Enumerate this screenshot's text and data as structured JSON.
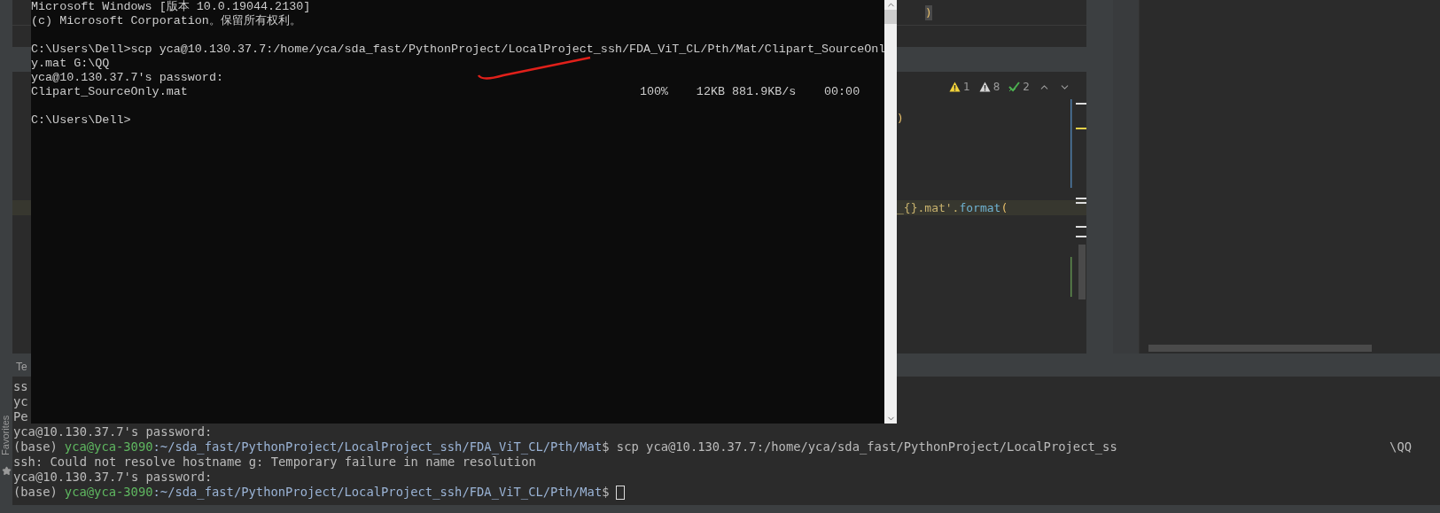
{
  "console_window": {
    "blocks": [
      [
        {
          "kind": "text",
          "text": "Microsoft Windows [版本 10.0.19044.2130]"
        },
        {
          "kind": "text",
          "text": "(c) Microsoft Corporation。保留所有权利。"
        }
      ],
      [
        {
          "kind": "text",
          "text": "C:\\Users\\Dell>scp yca@10.130.37.7:/home/yca/sda_fast/PythonProject/LocalProject_ssh/FDA_ViT_CL/Pth/Mat/Clipart_SourceOnl"
        },
        {
          "kind": "text",
          "text": "y.mat G:\\QQ"
        },
        {
          "kind": "text",
          "text": "yca@10.130.37.7's password:"
        },
        {
          "kind": "progress",
          "file": "Clipart_SourceOnly.mat",
          "percent": "100%",
          "size": "12KB",
          "speed": "881.9KB/s",
          "time": "00:00"
        }
      ],
      [
        {
          "kind": "text",
          "text": "C:\\Users\\Dell>"
        }
      ]
    ]
  },
  "editor": {
    "lines": [
      {
        "tokens": [
          {
            "kind": "paren",
            "text": ")"
          }
        ],
        "highlighted": false
      },
      {
        "tokens": [
          {
            "kind": "paren",
            "text": ")"
          }
        ],
        "highlighted": false
      },
      {
        "tokens": [
          {
            "kind": "string",
            "text": "_{}.mat'."
          },
          {
            "kind": "method",
            "text": "format"
          },
          {
            "kind": "paren",
            "text": "("
          }
        ],
        "highlighted": true
      }
    ],
    "inspections": [
      {
        "kind": "warning",
        "count": "1"
      },
      {
        "kind": "weak-warning",
        "count": "8"
      },
      {
        "kind": "typo",
        "count": "2"
      }
    ]
  },
  "terminal": {
    "tab": "Te",
    "hidden_lines": [
      "ss",
      "yc",
      "Pe"
    ],
    "lines": [
      {
        "kind": "output",
        "text": "yca@10.130.37.7's password:"
      },
      {
        "kind": "prompt",
        "env": "(base)",
        "user": "yca@yca-3090",
        "path": ":~/sda_fast/PythonProject/LocalProject_ssh/FDA_ViT_CL/Pth/Mat",
        "command": "$ scp yca@10.130.37.7:/home/yca/sda_fast/PythonProject/LocalProject_ss",
        "tail": "\\QQ",
        "cursor": false
      },
      {
        "kind": "output",
        "text": "ssh: Could not resolve hostname g: Temporary failure in name resolution"
      },
      {
        "kind": "output",
        "text": "yca@10.130.37.7's password:"
      },
      {
        "kind": "prompt",
        "env": "(base)",
        "user": "yca@yca-3090",
        "path": ":~/sda_fast/PythonProject/LocalProject_ssh/FDA_ViT_CL/Pth/Mat",
        "command": "$",
        "cursor": true
      }
    ]
  },
  "favorites_tab": {
    "label": "Favorites"
  }
}
